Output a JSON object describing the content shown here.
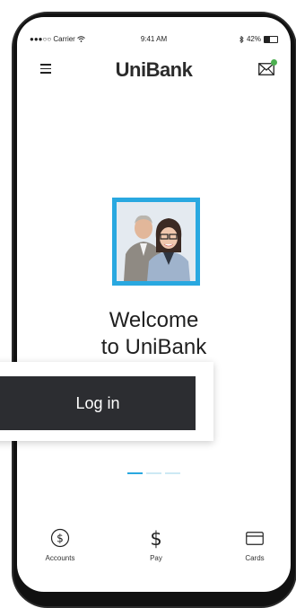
{
  "status_bar": {
    "carrier": "●●●○○ Carrier",
    "time": "9:41 AM",
    "battery": "42%",
    "battery_level": 0.42
  },
  "header": {
    "logo": "UniBank"
  },
  "welcome": {
    "line1": "Welcome",
    "line2": "to UniBank"
  },
  "login_button": "Log in",
  "pager": {
    "total": 3,
    "active": 1
  },
  "tabbar": {
    "items": [
      {
        "label": "Accounts",
        "icon": "dollar-circle-icon"
      },
      {
        "label": "Pay",
        "icon": "dollar-icon"
      },
      {
        "label": "Cards",
        "icon": "card-icon"
      }
    ]
  },
  "colors": {
    "accent": "#29a8e0",
    "button": "#2c2d31",
    "notification": "#4caf50"
  }
}
